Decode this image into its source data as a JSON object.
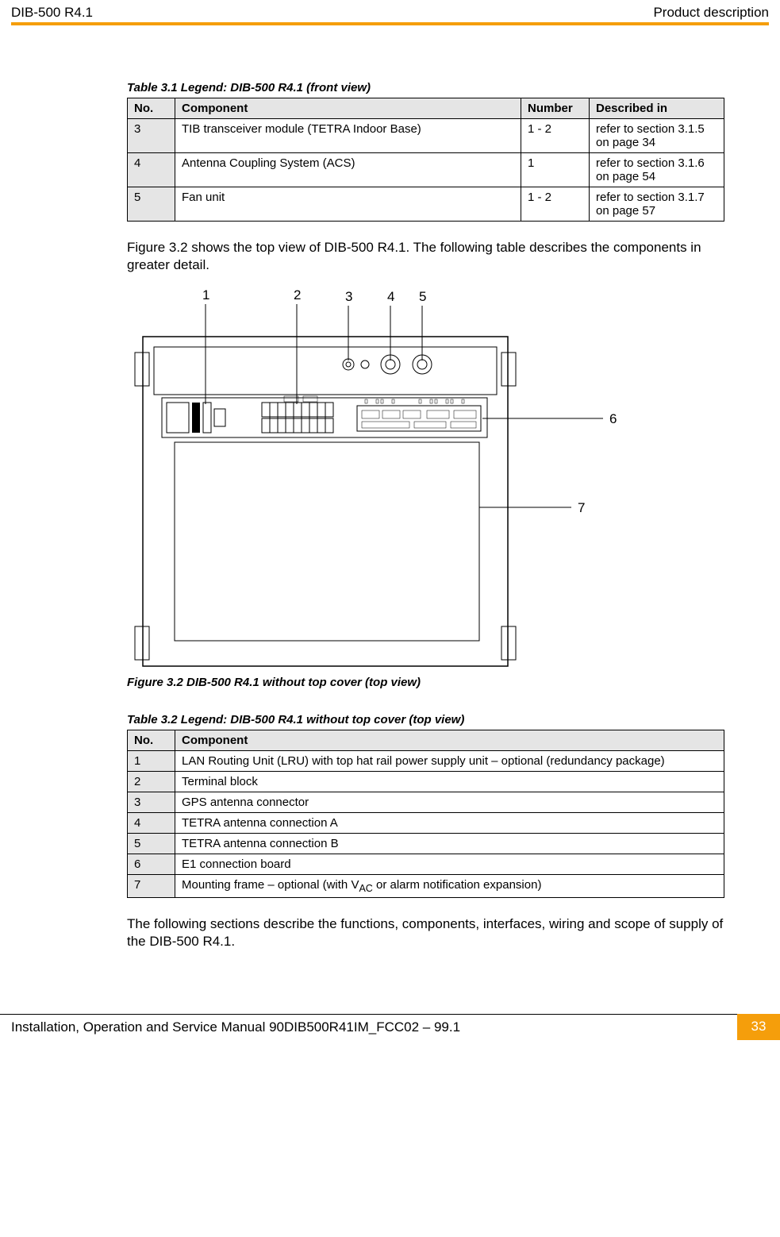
{
  "header": {
    "left": "DIB-500 R4.1",
    "right": "Product description"
  },
  "table31": {
    "caption": "Table 3.1   Legend: DIB-500 R4.1 (front view)",
    "headers": {
      "no": "No.",
      "component": "Component",
      "number": "Number",
      "described": "Described in"
    },
    "rows": [
      {
        "no": "3",
        "component": "TIB transceiver module (TETRA Indoor Base)",
        "number": "1 - 2",
        "described": "refer to section 3.1.5 on page 34"
      },
      {
        "no": "4",
        "component": "Antenna Coupling System (ACS)",
        "number": "1",
        "described": "refer to section 3.1.6 on page 54"
      },
      {
        "no": "5",
        "component": "Fan unit",
        "number": "1 - 2",
        "described": "refer to section 3.1.7 on page 57"
      }
    ]
  },
  "para1": "Figure 3.2 shows the top view of DIB-500 R4.1. The following table describes the components in greater detail.",
  "figure": {
    "callouts": {
      "c1": "1",
      "c2": "2",
      "c3": "3",
      "c4": "4",
      "c5": "5",
      "c6": "6",
      "c7": "7"
    },
    "caption": "Figure 3.2   DIB-500 R4.1 without top cover (top view)"
  },
  "table32": {
    "caption": "Table 3.2   Legend: DIB-500 R4.1 without top cover (top view)",
    "headers": {
      "no": "No.",
      "component": "Component"
    },
    "rows": [
      {
        "no": "1",
        "component": "LAN Routing Unit (LRU) with top hat rail power supply unit – optional (redundancy package)"
      },
      {
        "no": "2",
        "component": "Terminal block"
      },
      {
        "no": "3",
        "component": "GPS antenna connector"
      },
      {
        "no": "4",
        "component": "TETRA antenna connection A"
      },
      {
        "no": "5",
        "component": "TETRA antenna connection B"
      },
      {
        "no": "6",
        "component": "E1 connection board"
      },
      {
        "no": "7",
        "component_pre": "Mounting frame – optional (with V",
        "component_sub": "AC",
        "component_post": " or alarm notification expansion)"
      }
    ]
  },
  "para2": "The following sections describe the functions, components, interfaces, wiring and scope of supply of the DIB-500 R4.1.",
  "footer": {
    "left": "Installation, Operation and Service Manual 90DIB500R41IM_FCC02  –  99.1",
    "right": "33"
  }
}
